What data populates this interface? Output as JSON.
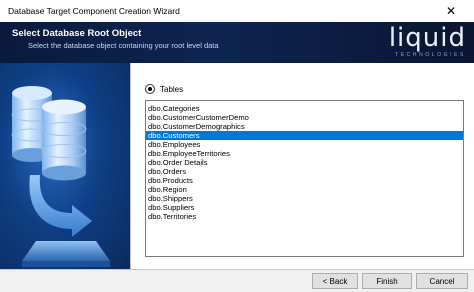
{
  "window": {
    "title": "Database Target Component Creation Wizard",
    "close_glyph": "✕"
  },
  "header": {
    "title": "Select Database Root Object",
    "subtitle": "Select the database object containing your root level data",
    "logo_word": "liquid",
    "logo_tagline": "TECHNOLOGIES"
  },
  "options": {
    "tables_label": "Tables"
  },
  "tables": [
    "dbo.Categories",
    "dbo.CustomerCustomerDemo",
    "dbo.CustomerDemographics",
    "dbo.Customers",
    "dbo.Employees",
    "dbo.EmployeeTerritories",
    "dbo.Order Details",
    "dbo.Orders",
    "dbo.Products",
    "dbo.Region",
    "dbo.Shippers",
    "dbo.Suppliers",
    "dbo.Territories"
  ],
  "selected_table": "dbo.Customers",
  "buttons": {
    "back": "< Back",
    "finish": "Finish",
    "cancel": "Cancel"
  },
  "colors": {
    "header_bg": "#0d2550",
    "selection": "#0078d7",
    "panel_bg": "#0f3f86"
  },
  "icons": {
    "close": "close-icon",
    "illustration": "database-import-icon"
  }
}
